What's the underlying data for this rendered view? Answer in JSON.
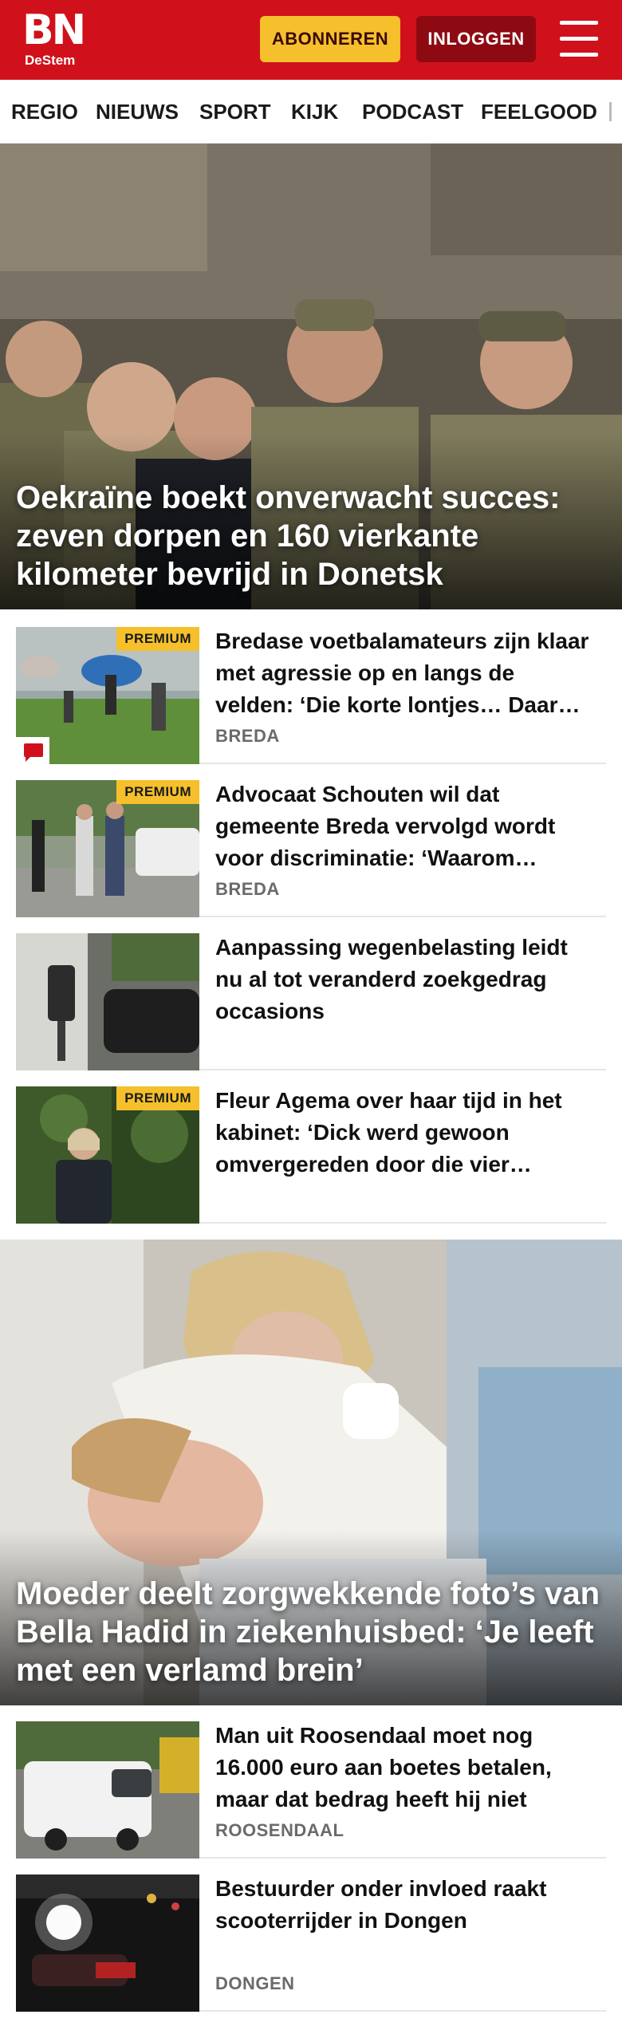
{
  "header": {
    "logo_main": "BN",
    "logo_sub": "DeStem",
    "subscribe_label": "ABONNEREN",
    "login_label": "INLOGGEN",
    "brand_color": "#d0111b",
    "subscribe_color": "#f5c02c",
    "login_color": "#8e0a12"
  },
  "nav": {
    "items": [
      "REGIO",
      "NIEUWS",
      "SPORT",
      "KIJK",
      "PODCAST",
      "FEELGOOD"
    ]
  },
  "hero1": {
    "title": "Oekraïne boekt onverwacht succes: zeven dorpen en 160 vierkante kilometer bevrijd in Donetsk"
  },
  "articles1": [
    {
      "title": "Bredase voetbalamateurs zijn klaar met agressie op en langs de velden: ‘Die korte lontjes… Daar…",
      "section": "BREDA",
      "premium": "PREMIUM"
    },
    {
      "title": "Advocaat Schouten wil dat gemeente Breda vervolgd wordt voor discriminatie: ‘Waarom…",
      "section": "BREDA",
      "premium": "PREMIUM"
    },
    {
      "title": "Aanpassing wegenbelasting leidt nu al tot veranderd zoekgedrag occasions",
      "section": "",
      "premium": ""
    },
    {
      "title": "Fleur Agema over haar tijd in het kabinet: ‘Dick werd gewoon omvergereden door die vier…",
      "section": "",
      "premium": "PREMIUM"
    }
  ],
  "hero2": {
    "title": "Moeder deelt zorgwekkende foto’s van Bella Hadid in ziekenhuisbed: ‘Je leeft met een verlamd brein’"
  },
  "articles2": [
    {
      "title": "Man uit Roosendaal moet nog 16.000 euro aan boetes betalen, maar dat bedrag heeft hij niet",
      "section": "ROOSENDAAL"
    },
    {
      "title": "Bestuurder onder invloed raakt scooterrijder in Dongen",
      "section": "DONGEN"
    }
  ],
  "icons": {
    "menu": "hamburger-menu-icon",
    "comment": "comment-icon"
  }
}
